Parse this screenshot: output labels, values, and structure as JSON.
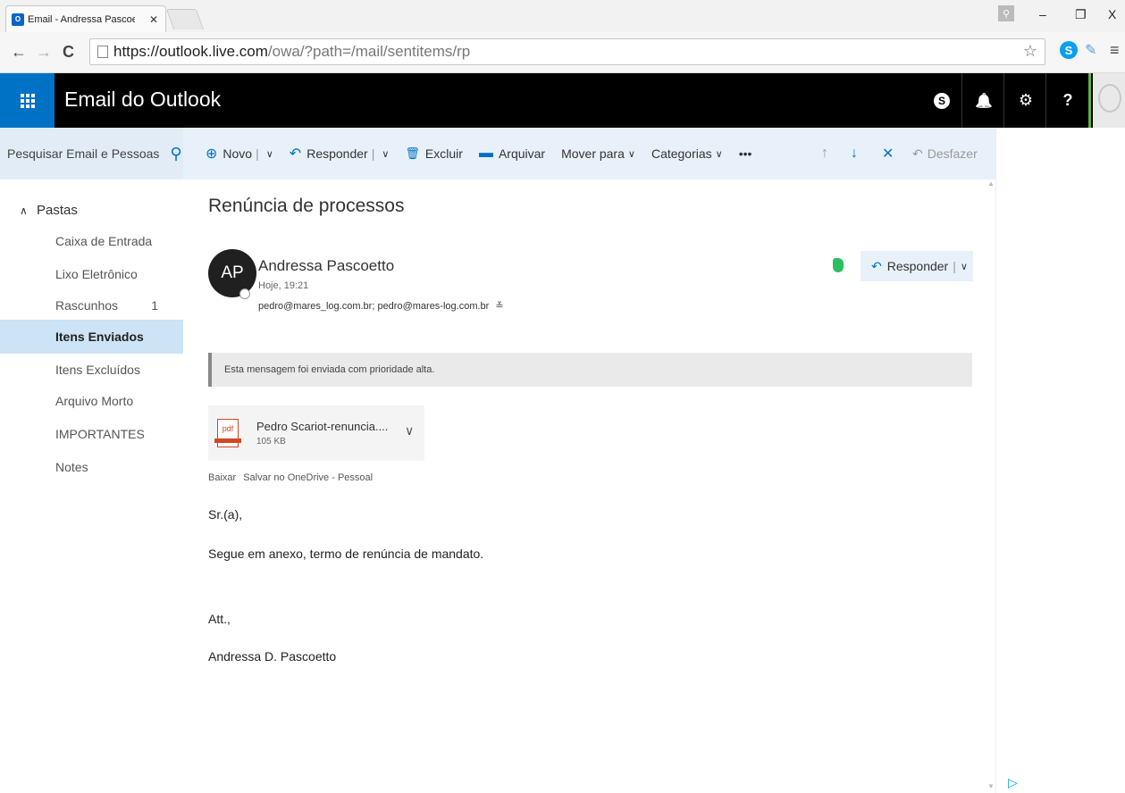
{
  "browser": {
    "tab_title": "Email - Andressa Pascoetto",
    "tab_favicon": "O",
    "tab_close": "✕",
    "url_host": "https://outlook.live.com",
    "url_path": "/owa/?path=/mail/sentitems/rp",
    "back": "←",
    "forward": "→",
    "reload": "C",
    "star": "☆",
    "ext_s": "S",
    "ext_clip": "✎",
    "menu": "≡",
    "minimize": "–",
    "restore": "❐",
    "close": "X",
    "profile": "⚲"
  },
  "header": {
    "app_title": "Email do Outlook",
    "skype": "S",
    "bell": "🔔",
    "gear": "⚙",
    "help": "?"
  },
  "search": {
    "placeholder": "Pesquisar Email e Pessoas",
    "icon": "⚲"
  },
  "toolbar": {
    "new_icon": "⊕",
    "new_label": "Novo",
    "reply_icon": "↶",
    "reply_label": "Responder",
    "delete_icon": "🗑",
    "delete_label": "Excluir",
    "archive_icon": "▬",
    "archive_label": "Arquivar",
    "move_label": "Mover para",
    "categories_label": "Categorias",
    "more_label": "•••",
    "chevron": "∨",
    "pipe": "|",
    "up": "↑",
    "down": "↓",
    "close": "✕",
    "undo_icon": "↶",
    "undo_label": "Desfazer"
  },
  "folders": {
    "header": "Pastas",
    "header_caret": "∧",
    "items": [
      {
        "label": "Caixa de Entrada",
        "count": ""
      },
      {
        "label": "Lixo Eletrônico",
        "count": ""
      },
      {
        "label": "Rascunhos",
        "count": "1"
      },
      {
        "label": "Itens Enviados",
        "count": "",
        "active": true
      },
      {
        "label": "Itens Excluídos",
        "count": ""
      },
      {
        "label": "Arquivo Morto",
        "count": ""
      },
      {
        "label": "IMPORTANTES",
        "count": ""
      },
      {
        "label": "Notes",
        "count": ""
      }
    ]
  },
  "message": {
    "subject": "Renúncia de processos",
    "sender_initials": "AP",
    "sender_name": "Andressa Pascoetto",
    "sent_time": "Hoje, 19:21",
    "recipients": "pedro@mares_log.com.br; pedro@mares-log.com.br",
    "recipients_expand": "≚",
    "reply_button": "Responder",
    "priority_notice": "Esta mensagem foi enviada com prioridade alta.",
    "attachment": {
      "type_label": "pdf",
      "name": "Pedro Scariot-renuncia....",
      "size": "105 KB",
      "chevron": "∨"
    },
    "attachment_actions": [
      "Baixar",
      "Salvar no OneDrive - Pessoal"
    ],
    "body": [
      "Sr.(a),",
      "Segue em anexo, termo de renúncia de mandato.",
      "Att.,",
      "Andressa D. Pascoetto"
    ]
  },
  "misc": {
    "scroll_up": "▲",
    "scroll_down": "▼",
    "ad_icon": "▷"
  }
}
